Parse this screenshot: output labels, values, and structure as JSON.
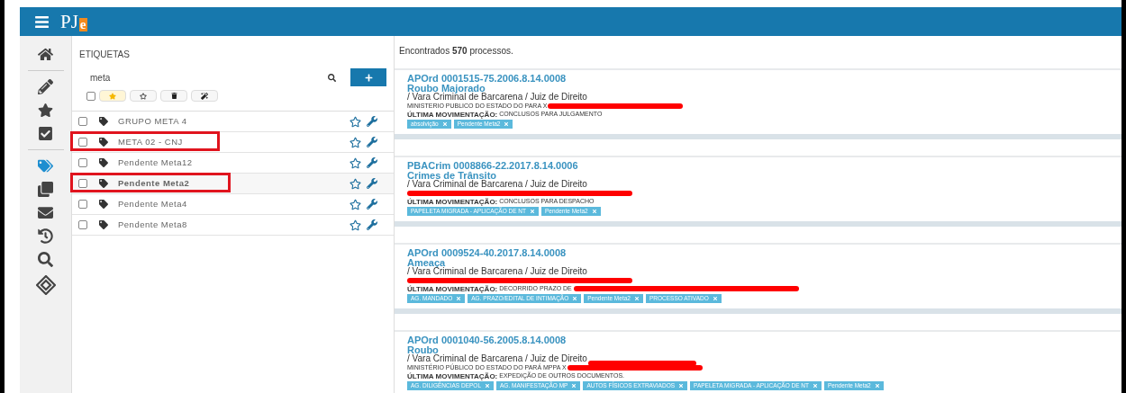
{
  "header": {
    "logo": "PJ",
    "logo_accent": "e"
  },
  "sidebar": {
    "items": [
      {
        "selected": false
      },
      {
        "selected": false
      },
      {
        "selected": false
      },
      {
        "selected": false
      },
      {
        "selected": true
      },
      {
        "selected": false
      },
      {
        "selected": false
      },
      {
        "selected": false
      },
      {
        "selected": false
      },
      {
        "selected": false
      }
    ]
  },
  "tags_panel": {
    "title": "ETIQUETAS",
    "search": {
      "value": "meta"
    },
    "toolbar": {
      "all_checked": false,
      "favorites_selected": true
    },
    "items": [
      {
        "name": "GRUPO META 4",
        "checked": false,
        "selected": false,
        "annotated": false
      },
      {
        "name": "META 02 - CNJ",
        "checked": false,
        "selected": false,
        "annotated": true
      },
      {
        "name": "Pendente Meta12",
        "checked": false,
        "selected": false,
        "annotated": false
      },
      {
        "name": "Pendente Meta2",
        "checked": false,
        "selected": true,
        "annotated": true
      },
      {
        "name": "Pendente Meta4",
        "checked": false,
        "selected": false,
        "annotated": false
      },
      {
        "name": "Pendente Meta8",
        "checked": false,
        "selected": false,
        "annotated": false
      }
    ]
  },
  "results": {
    "summary": "Encontrados **570** processos.",
    "cards": [
      {
        "number": "APOrd 0001515-75.2006.8.14.0008",
        "subject": "Roubo Majorado",
        "court": {
          "text": "/ Vara Criminal de Barcarena / Juiz de Direito",
          "redacted": false
        },
        "parties": {
          "text": "MINISTERIO PUBLICO DO ESTADO DO PARA X",
          "redacted": true
        },
        "last_move": {
          "label": "ÚLTIMA MOVIMENTAÇÃO:",
          "text": "CONCLUSOS PARA JULGAMENTO",
          "redacted": false
        },
        "tags": [
          "absolvição",
          "Pendente Meta2"
        ]
      },
      {
        "number": "PBACrim 0008866-22.2017.8.14.0006",
        "subject": "Crimes de Trânsito",
        "court": {
          "text": "/ Vara Criminal de Barcarena / Juiz de Direito",
          "redacted": false
        },
        "parties": {
          "redacted": true
        },
        "last_move": {
          "label": "ÚLTIMA MOVIMENTAÇÃO:",
          "text": "CONCLUSOS PARA DESPACHO",
          "redacted": false
        },
        "tags": [
          "PAPELETA MIGRADA - APLICAÇÃO DE NT",
          "Pendente Meta2"
        ]
      },
      {
        "number": "APOrd 0009524-40.2017.8.14.0008",
        "subject": "Ameaça",
        "court": {
          "text": "/ Vara Criminal de Barcarena / Juiz de Direito",
          "redacted": false
        },
        "parties": {
          "redacted": true
        },
        "last_move": {
          "label": "ÚLTIMA MOVIMENTAÇÃO:",
          "text": "DECORRIDO PRAZO DE",
          "redacted": true
        },
        "tags": [
          "AG. MANDADO",
          "AG. PRAZO/EDITAL DE INTIMAÇÃO",
          "Pendente Meta2",
          "PROCESSO ATIVADO"
        ]
      },
      {
        "number": "APOrd 0001040-56.2005.8.14.0008",
        "subject": "Roubo",
        "court": {
          "text": "/ Vara Criminal de Barcarena / Juiz de Direito",
          "redacted": true
        },
        "parties": {
          "text": "MINISTÉRIO PÚBLICO DO ESTADO DO PARÁ MPPA X",
          "redacted": true
        },
        "last_move": {
          "label": "ÚLTIMA MOVIMENTAÇÃO:",
          "text": "EXPEDIÇÃO DE OUTROS DOCUMENTOS.",
          "redacted": false
        },
        "tags": [
          "AG. DILIGÊNCIAS DEPOL",
          "AG. MANIFESTAÇÃO MP",
          "AUTOS FÍSICOS EXTRAVIADOS",
          "PAPELETA MIGRADA - APLICAÇÃO DE NT",
          "Pendente Meta2"
        ]
      }
    ]
  }
}
